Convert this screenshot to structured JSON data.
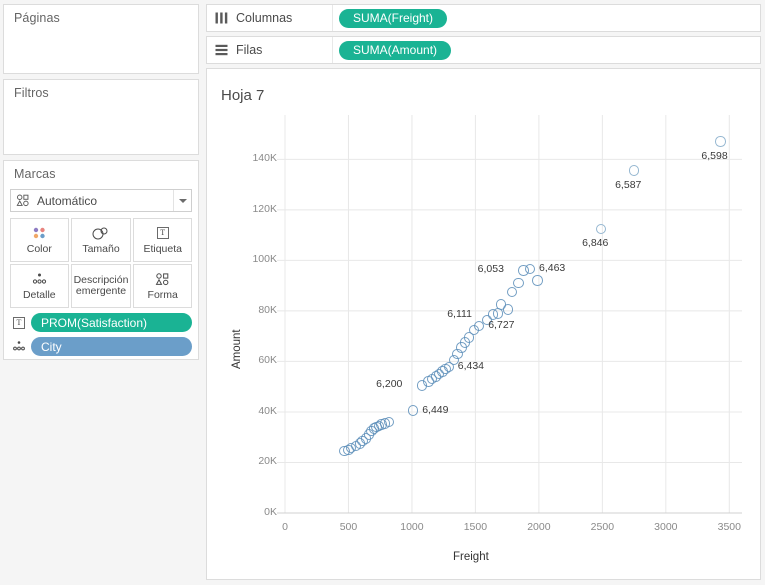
{
  "left_panel": {
    "pages": {
      "title": "Páginas"
    },
    "filters": {
      "title": "Filtros"
    },
    "marks": {
      "title": "Marcas",
      "mark_type": "Automático",
      "mark_type_icon": "shapes-icon",
      "dropdown_icon": "chevron-down-icon",
      "buttons": [
        {
          "label": "Color",
          "icon": "color-palette-icon"
        },
        {
          "label": "Tamaño",
          "icon": "size-icon"
        },
        {
          "label": "Etiqueta",
          "icon": "label-text-icon"
        },
        {
          "label": "Detalle",
          "icon": "detail-dots-icon"
        },
        {
          "label": "Descripción emergente",
          "icon": "tooltip-icon"
        },
        {
          "label": "Forma",
          "icon": "shape-icon"
        }
      ],
      "pills": [
        {
          "text": "PROM(Satisfaction)",
          "color": "#1ab394",
          "kind": "green",
          "icon": "label-text-icon"
        },
        {
          "text": "City",
          "color": "#6b9ec9",
          "kind": "blue",
          "icon": "detail-dots-icon"
        }
      ]
    }
  },
  "shelves": {
    "columns": {
      "label": "Columnas",
      "icon": "columns-icon",
      "pill": "SUMA(Freight)"
    },
    "rows": {
      "label": "Filas",
      "icon": "rows-icon",
      "pill": "SUMA(Amount)"
    }
  },
  "worksheet": {
    "title": "Hoja 7"
  },
  "colors": {
    "pill_green": "#1ab394",
    "pill_blue": "#6b9ec9",
    "mark_fill": "#5b8db8",
    "grid": "#e8e8e8",
    "panel_bg": "#f5f5f5"
  },
  "chart_data": {
    "type": "scatter",
    "title": "Hoja 7",
    "xlabel": "Freight",
    "ylabel": "Amount",
    "xlim": [
      0,
      3600
    ],
    "ylim": [
      0,
      152000
    ],
    "xticks": [
      0,
      500,
      1000,
      1500,
      2000,
      2500,
      3000,
      3500
    ],
    "xticklabels": [
      "0",
      "500",
      "1000",
      "1500",
      "2000",
      "2500",
      "3000",
      "3500"
    ],
    "yticks": [
      0,
      20000,
      40000,
      60000,
      80000,
      100000,
      120000,
      140000
    ],
    "yticklabels": [
      "0K",
      "20K",
      "40K",
      "60K",
      "80K",
      "100K",
      "120K",
      "140K"
    ],
    "grid": true,
    "legend": false,
    "mark_shape": "open-circle",
    "points": [
      {
        "x": 470,
        "y": 24500
      },
      {
        "x": 500,
        "y": 25000
      },
      {
        "x": 520,
        "y": 25800
      },
      {
        "x": 560,
        "y": 26500
      },
      {
        "x": 590,
        "y": 27500
      },
      {
        "x": 610,
        "y": 28500
      },
      {
        "x": 640,
        "y": 29500
      },
      {
        "x": 660,
        "y": 31000
      },
      {
        "x": 680,
        "y": 32500
      },
      {
        "x": 700,
        "y": 33500
      },
      {
        "x": 720,
        "y": 34000
      },
      {
        "x": 740,
        "y": 34500
      },
      {
        "x": 760,
        "y": 35000
      },
      {
        "x": 790,
        "y": 35500
      },
      {
        "x": 820,
        "y": 36000
      },
      {
        "x": 1010,
        "y": 40500,
        "label": "6,449"
      },
      {
        "x": 1080,
        "y": 50500,
        "label": "6,200"
      },
      {
        "x": 1130,
        "y": 52000
      },
      {
        "x": 1160,
        "y": 53000
      },
      {
        "x": 1190,
        "y": 54000
      },
      {
        "x": 1215,
        "y": 55000
      },
      {
        "x": 1240,
        "y": 56000
      },
      {
        "x": 1265,
        "y": 57000
      },
      {
        "x": 1290,
        "y": 57800,
        "label": "6,434"
      },
      {
        "x": 1330,
        "y": 60500
      },
      {
        "x": 1360,
        "y": 63000
      },
      {
        "x": 1390,
        "y": 65500
      },
      {
        "x": 1420,
        "y": 67500
      },
      {
        "x": 1450,
        "y": 69500
      },
      {
        "x": 1490,
        "y": 72500
      },
      {
        "x": 1530,
        "y": 74000,
        "label": "6,727"
      },
      {
        "x": 1590,
        "y": 76500
      },
      {
        "x": 1640,
        "y": 78500,
        "label": "6,111"
      },
      {
        "x": 1680,
        "y": 79000
      },
      {
        "x": 1700,
        "y": 82500
      },
      {
        "x": 1755,
        "y": 80500
      },
      {
        "x": 1790,
        "y": 87500
      },
      {
        "x": 1840,
        "y": 91000
      },
      {
        "x": 1880,
        "y": 96000,
        "label": "6,053"
      },
      {
        "x": 1930,
        "y": 96500,
        "label": "6,463"
      },
      {
        "x": 1990,
        "y": 92000
      },
      {
        "x": 2490,
        "y": 112500,
        "label": "6,846"
      },
      {
        "x": 2750,
        "y": 135500,
        "label": "6,587"
      },
      {
        "x": 3430,
        "y": 147000,
        "label": "6,598"
      }
    ]
  }
}
